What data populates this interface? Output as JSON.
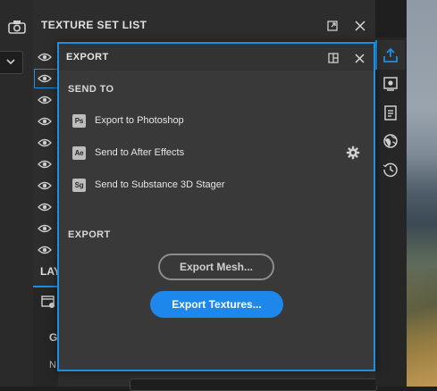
{
  "texture_set_panel": {
    "title": "TEXTURE SET LIST",
    "row_count": 10
  },
  "layers_panel": {
    "tab_label": "LAY",
    "group_letter": "G",
    "field_letter": "N"
  },
  "export_popup": {
    "title": "EXPORT",
    "send_to": {
      "title": "SEND TO",
      "items": [
        {
          "badge": "Ps",
          "label": "Export to Photoshop"
        },
        {
          "badge": "Ae",
          "label": "Send to After Effects"
        },
        {
          "badge": "Sg",
          "label": "Send to Substance 3D Stager"
        }
      ]
    },
    "export": {
      "title": "EXPORT",
      "mesh_button": "Export Mesh...",
      "textures_button": "Export Textures..."
    }
  },
  "right_toolbar": {
    "icons": [
      "export-icon",
      "display-settings-icon",
      "notes-icon",
      "environment-icon",
      "history-icon"
    ],
    "active": "export-icon"
  },
  "colors": {
    "accent": "#1e8fe0",
    "primary_button": "#1e87eb",
    "popup_bg": "#393939"
  }
}
